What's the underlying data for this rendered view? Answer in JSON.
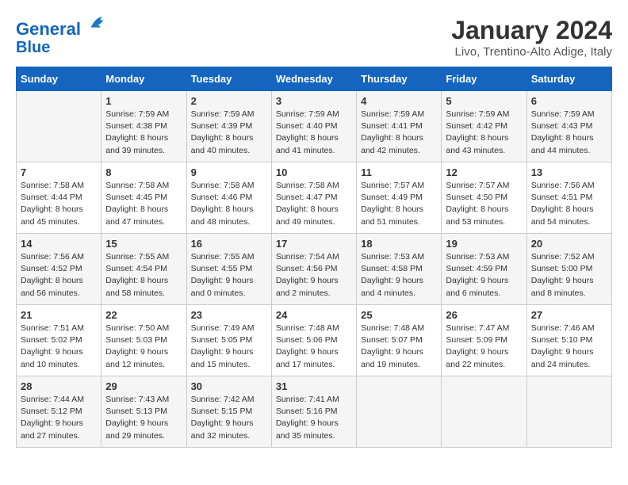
{
  "header": {
    "logo_line1": "General",
    "logo_line2": "Blue",
    "month_title": "January 2024",
    "location": "Livo, Trentino-Alto Adige, Italy"
  },
  "weekdays": [
    "Sunday",
    "Monday",
    "Tuesday",
    "Wednesday",
    "Thursday",
    "Friday",
    "Saturday"
  ],
  "weeks": [
    [
      {
        "day": "",
        "info": ""
      },
      {
        "day": "1",
        "info": "Sunrise: 7:59 AM\nSunset: 4:38 PM\nDaylight: 8 hours\nand 39 minutes."
      },
      {
        "day": "2",
        "info": "Sunrise: 7:59 AM\nSunset: 4:39 PM\nDaylight: 8 hours\nand 40 minutes."
      },
      {
        "day": "3",
        "info": "Sunrise: 7:59 AM\nSunset: 4:40 PM\nDaylight: 8 hours\nand 41 minutes."
      },
      {
        "day": "4",
        "info": "Sunrise: 7:59 AM\nSunset: 4:41 PM\nDaylight: 8 hours\nand 42 minutes."
      },
      {
        "day": "5",
        "info": "Sunrise: 7:59 AM\nSunset: 4:42 PM\nDaylight: 8 hours\nand 43 minutes."
      },
      {
        "day": "6",
        "info": "Sunrise: 7:59 AM\nSunset: 4:43 PM\nDaylight: 8 hours\nand 44 minutes."
      }
    ],
    [
      {
        "day": "7",
        "info": "Sunrise: 7:58 AM\nSunset: 4:44 PM\nDaylight: 8 hours\nand 45 minutes."
      },
      {
        "day": "8",
        "info": "Sunrise: 7:58 AM\nSunset: 4:45 PM\nDaylight: 8 hours\nand 47 minutes."
      },
      {
        "day": "9",
        "info": "Sunrise: 7:58 AM\nSunset: 4:46 PM\nDaylight: 8 hours\nand 48 minutes."
      },
      {
        "day": "10",
        "info": "Sunrise: 7:58 AM\nSunset: 4:47 PM\nDaylight: 8 hours\nand 49 minutes."
      },
      {
        "day": "11",
        "info": "Sunrise: 7:57 AM\nSunset: 4:49 PM\nDaylight: 8 hours\nand 51 minutes."
      },
      {
        "day": "12",
        "info": "Sunrise: 7:57 AM\nSunset: 4:50 PM\nDaylight: 8 hours\nand 53 minutes."
      },
      {
        "day": "13",
        "info": "Sunrise: 7:56 AM\nSunset: 4:51 PM\nDaylight: 8 hours\nand 54 minutes."
      }
    ],
    [
      {
        "day": "14",
        "info": "Sunrise: 7:56 AM\nSunset: 4:52 PM\nDaylight: 8 hours\nand 56 minutes."
      },
      {
        "day": "15",
        "info": "Sunrise: 7:55 AM\nSunset: 4:54 PM\nDaylight: 8 hours\nand 58 minutes."
      },
      {
        "day": "16",
        "info": "Sunrise: 7:55 AM\nSunset: 4:55 PM\nDaylight: 9 hours\nand 0 minutes."
      },
      {
        "day": "17",
        "info": "Sunrise: 7:54 AM\nSunset: 4:56 PM\nDaylight: 9 hours\nand 2 minutes."
      },
      {
        "day": "18",
        "info": "Sunrise: 7:53 AM\nSunset: 4:58 PM\nDaylight: 9 hours\nand 4 minutes."
      },
      {
        "day": "19",
        "info": "Sunrise: 7:53 AM\nSunset: 4:59 PM\nDaylight: 9 hours\nand 6 minutes."
      },
      {
        "day": "20",
        "info": "Sunrise: 7:52 AM\nSunset: 5:00 PM\nDaylight: 9 hours\nand 8 minutes."
      }
    ],
    [
      {
        "day": "21",
        "info": "Sunrise: 7:51 AM\nSunset: 5:02 PM\nDaylight: 9 hours\nand 10 minutes."
      },
      {
        "day": "22",
        "info": "Sunrise: 7:50 AM\nSunset: 5:03 PM\nDaylight: 9 hours\nand 12 minutes."
      },
      {
        "day": "23",
        "info": "Sunrise: 7:49 AM\nSunset: 5:05 PM\nDaylight: 9 hours\nand 15 minutes."
      },
      {
        "day": "24",
        "info": "Sunrise: 7:48 AM\nSunset: 5:06 PM\nDaylight: 9 hours\nand 17 minutes."
      },
      {
        "day": "25",
        "info": "Sunrise: 7:48 AM\nSunset: 5:07 PM\nDaylight: 9 hours\nand 19 minutes."
      },
      {
        "day": "26",
        "info": "Sunrise: 7:47 AM\nSunset: 5:09 PM\nDaylight: 9 hours\nand 22 minutes."
      },
      {
        "day": "27",
        "info": "Sunrise: 7:46 AM\nSunset: 5:10 PM\nDaylight: 9 hours\nand 24 minutes."
      }
    ],
    [
      {
        "day": "28",
        "info": "Sunrise: 7:44 AM\nSunset: 5:12 PM\nDaylight: 9 hours\nand 27 minutes."
      },
      {
        "day": "29",
        "info": "Sunrise: 7:43 AM\nSunset: 5:13 PM\nDaylight: 9 hours\nand 29 minutes."
      },
      {
        "day": "30",
        "info": "Sunrise: 7:42 AM\nSunset: 5:15 PM\nDaylight: 9 hours\nand 32 minutes."
      },
      {
        "day": "31",
        "info": "Sunrise: 7:41 AM\nSunset: 5:16 PM\nDaylight: 9 hours\nand 35 minutes."
      },
      {
        "day": "",
        "info": ""
      },
      {
        "day": "",
        "info": ""
      },
      {
        "day": "",
        "info": ""
      }
    ]
  ]
}
